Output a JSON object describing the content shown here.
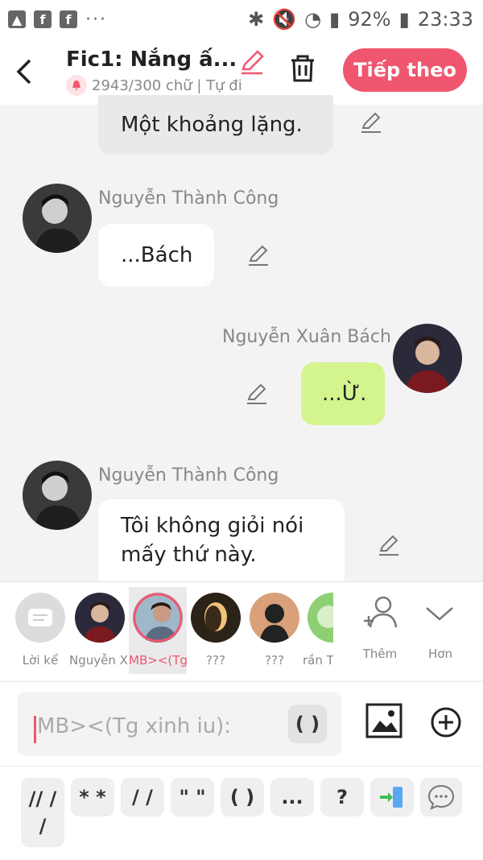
{
  "status": {
    "battery": "92%",
    "time": "23:33"
  },
  "header": {
    "title": "Fic1: Nắng ấ...",
    "subtitle": "2943/300 chữ | Tự đi",
    "next_label": "Tiếp theo"
  },
  "messages": [
    {
      "text": "Một khoảng lặng."
    },
    {
      "sender": "Nguyễn Thành Công",
      "text": "...Bách"
    },
    {
      "sender": "Nguyễn Xuân Bách",
      "text": "...Ừ."
    },
    {
      "sender": "Nguyễn Thành Công",
      "text": "Tôi không giỏi nói\nmấy thứ này."
    }
  ],
  "characters": [
    {
      "label": "Lời kể"
    },
    {
      "label": "Nguyễn X..."
    },
    {
      "label": "MB><(Tg x..."
    },
    {
      "label": "???"
    },
    {
      "label": "???"
    },
    {
      "label": "rần T"
    }
  ],
  "char_actions": {
    "add": "Thêm",
    "more": "Hơn"
  },
  "input": {
    "placeholder": "MB><(Tg xinh iu):",
    "paren": "( )"
  },
  "quick_keys": [
    "// /\n/",
    "* *",
    "/ /",
    "\" \"",
    "( )",
    "...",
    "?"
  ],
  "colors": {
    "accent": "#f0566e",
    "green_bubble": "#d4f58d"
  }
}
